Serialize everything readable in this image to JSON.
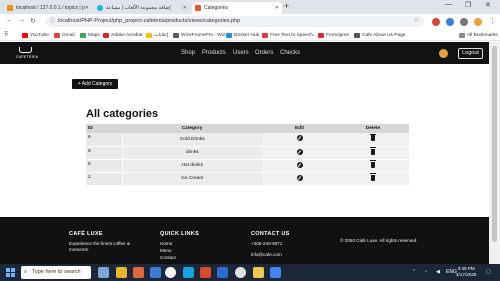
{
  "browser": {
    "tabs": [
      {
        "title": "localhost / 127.0.0.1 / topics | p"
      },
      {
        "title": "إضافة مجموعة الألعاب | مساعد"
      },
      {
        "title": "Categories"
      }
    ],
    "url": "localhost/PHP-Project/php_project-cafeteria/products/views/categories.php",
    "bookmarks": [
      "YouTube",
      "Gmail",
      "Maps",
      "Adobe Acrobat",
      "إعلانات",
      "WizeFramePro - Wiz...",
      "Docker Hub",
      "Free Text to Speech...",
      "Formspree",
      "Cafe About Us Page"
    ],
    "all_bookmarks": "All Bookmarks"
  },
  "site": {
    "logo_text": "CAFETERIA",
    "nav": [
      "Shop",
      "Products",
      "Users",
      "Orders",
      "Checks"
    ],
    "logout": "Logout"
  },
  "main": {
    "add_button": "+ Add Category",
    "title": "All categories",
    "columns": [
      "ID",
      "Category",
      "Edit",
      "Delete"
    ],
    "rows": [
      {
        "id": "6",
        "name": "Cold Drinks"
      },
      {
        "id": "8",
        "name": "drinks"
      },
      {
        "id": "5",
        "name": "Hot drinks"
      },
      {
        "id": "2",
        "name": "Ice Cream"
      }
    ]
  },
  "footer": {
    "brand": "CAFÉ LUXE",
    "brand_text": "Experience the finest coffee & moments.",
    "quick_links_title": "QUICK LINKS",
    "links": [
      "Home",
      "Menu",
      "Contact"
    ],
    "contact_title": "CONTACT US",
    "phone": "+305-240-9671",
    "email": "info@cafe.com",
    "copyright": "© 2050 Café Luxe. All rights reserved."
  },
  "taskbar": {
    "search_placeholder": "Type here to search",
    "time": "3:49 PM",
    "date": "3/17/2025"
  },
  "colors": {
    "header_bg": "#121212",
    "footer_bg": "#111111",
    "taskbar_bg": "#1b2638",
    "table_header": "#d6d6d6"
  }
}
